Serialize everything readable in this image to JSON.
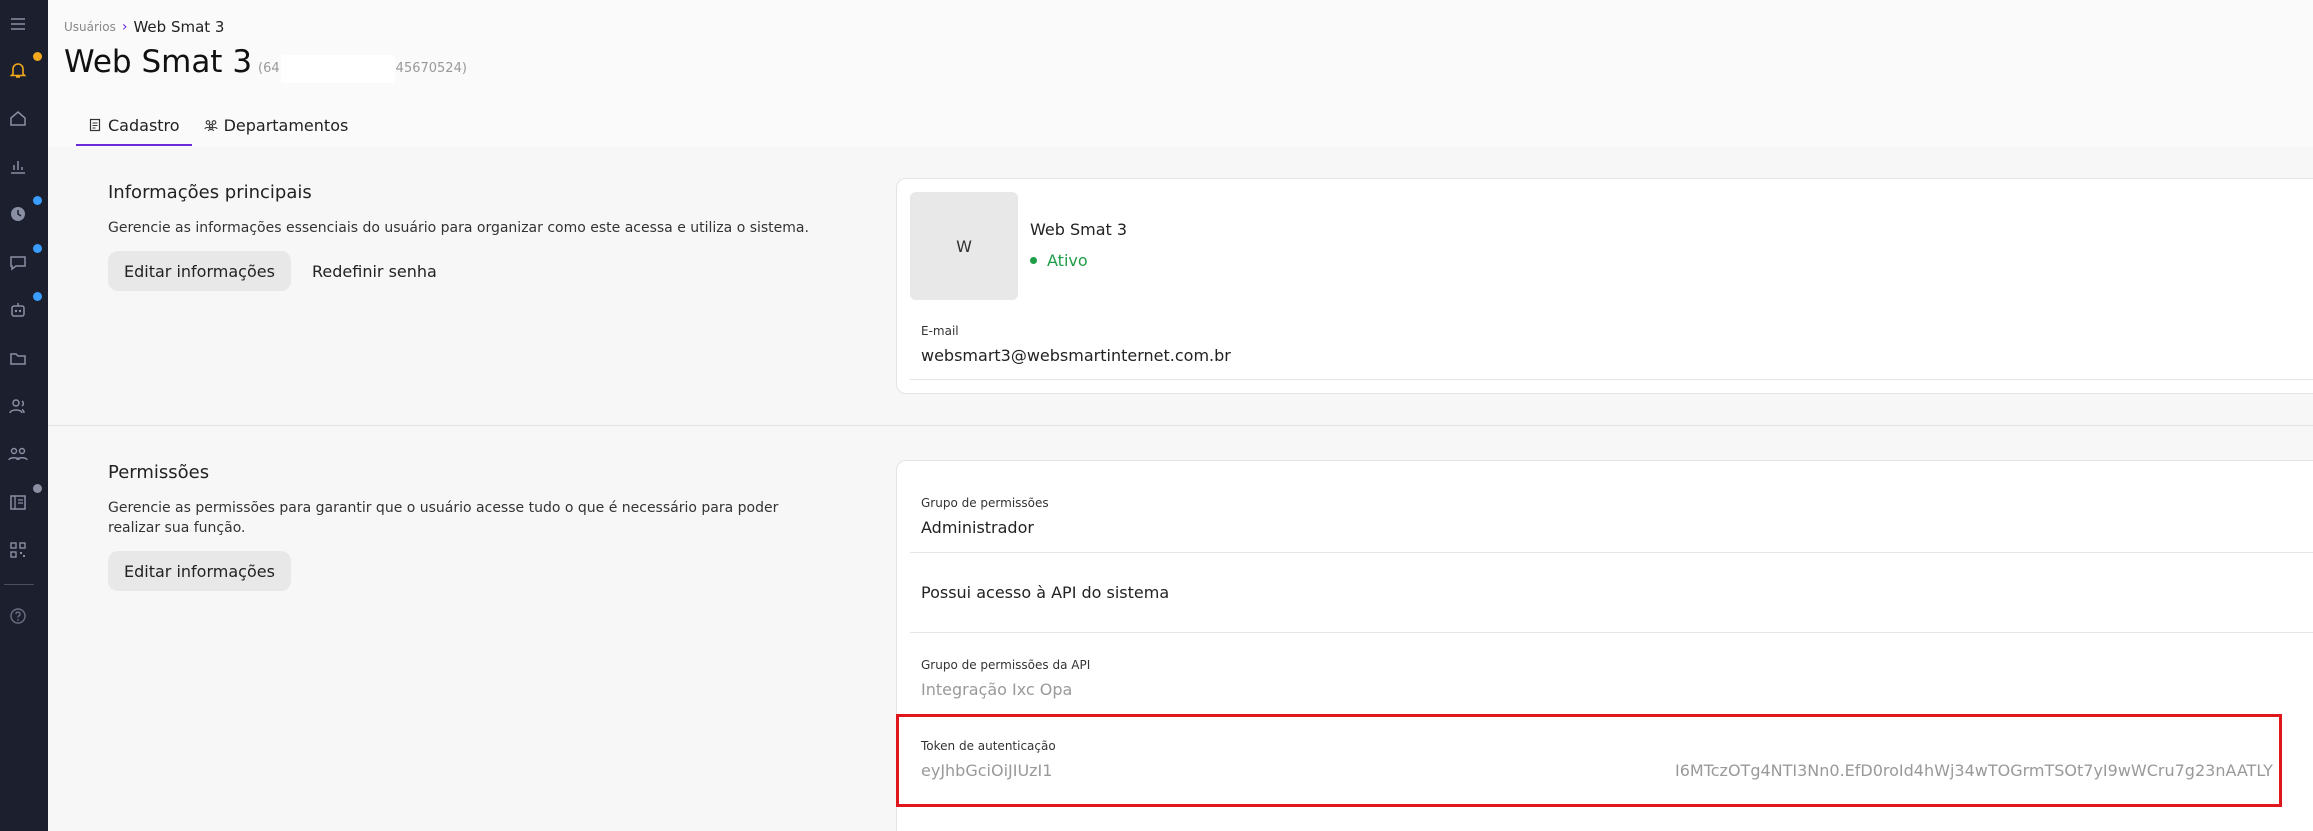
{
  "breadcrumb": {
    "parent": "Usuários",
    "current": "Web Smat 3"
  },
  "title": {
    "name": "Web Smat 3",
    "id_prefix": "(64",
    "id_suffix": "45670524)"
  },
  "tabs": [
    {
      "label": "Cadastro",
      "icon": "document-icon",
      "active": true
    },
    {
      "label": "Departamentos",
      "icon": "users-group-icon",
      "active": false
    }
  ],
  "main_info": {
    "title": "Informações principais",
    "description": "Gerencie as informações essenciais do usuário para organizar como este acessa e utiliza o sistema.",
    "edit_label": "Editar informações",
    "reset_label": "Redefinir senha"
  },
  "user_card": {
    "avatar_initial": "W",
    "name": "Web Smat 3",
    "status": "Ativo",
    "email_label": "E-mail",
    "email_value": "websmart3@websmartinternet.com.br"
  },
  "permissions": {
    "title": "Permissões",
    "description": "Gerencie as permissões para garantir que o usuário acesse tudo o que é necessário para poder realizar sua função.",
    "edit_label": "Editar informações",
    "group_label": "Grupo de permissões",
    "group_value": "Administrador",
    "api_access_label": "Possui acesso à API do sistema",
    "api_group_label": "Grupo de permissões da API",
    "api_group_value": "Integração Ixc Opa",
    "token_label": "Token de autenticação",
    "token_prefix": "eyJhbGciOiJIUzI1N",
    "token_suffix": "I6MTczOTg4NTI3Nn0.EfD0roId4hWj34wTOGrmTSOt7yI9wWCru7g23nAATLY"
  },
  "colors": {
    "accent": "#6c2bd9",
    "status_active": "#1e9e46",
    "highlight": "#e0161d",
    "sidebar_bg": "#1c1f2e"
  }
}
